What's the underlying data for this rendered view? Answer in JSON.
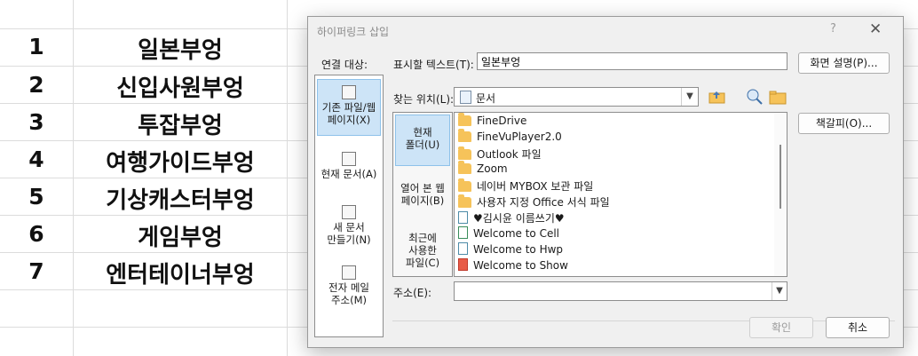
{
  "sheet": {
    "rows": [
      {
        "num": "1",
        "text": "일본부엉"
      },
      {
        "num": "2",
        "text": "신입사원부엉"
      },
      {
        "num": "3",
        "text": "투잡부엉"
      },
      {
        "num": "4",
        "text": "여행가이드부엉"
      },
      {
        "num": "5",
        "text": "기상캐스터부엉"
      },
      {
        "num": "6",
        "text": "게임부엉"
      },
      {
        "num": "7",
        "text": "엔터테이너부엉"
      }
    ]
  },
  "dialog": {
    "title": "하이퍼링크 삽입",
    "help": "?",
    "close": "✕",
    "link_to_label": "연결 대상:",
    "display_text_label": "표시할 텍스트(T):",
    "display_text_value": "일본부엉",
    "screentip_button": "화면 설명(P)...",
    "look_in_label": "찾는 위치(L):",
    "look_in_value": "문서",
    "bookmark_button": "책갈피(O)...",
    "link_types": [
      {
        "label1": "기존 파일/웹",
        "label2": "페이지(X)"
      },
      {
        "label1": "현재 문서(A)",
        "label2": ""
      },
      {
        "label1": "새 문서",
        "label2": "만들기(N)"
      },
      {
        "label1": "전자 메일",
        "label2": "주소(M)"
      }
    ],
    "locations": [
      {
        "label1": "현재",
        "label2": "폴더(U)",
        "label3": ""
      },
      {
        "label1": "열어 본 웹",
        "label2": "페이지(B)",
        "label3": ""
      },
      {
        "label1": "최근에",
        "label2": "사용한",
        "label3": "파일(C)"
      }
    ],
    "files": [
      {
        "name": "FineDrive",
        "type": "folder"
      },
      {
        "name": "FineVuPlayer2.0",
        "type": "folder"
      },
      {
        "name": "Outlook 파일",
        "type": "folder"
      },
      {
        "name": "Zoom",
        "type": "folder"
      },
      {
        "name": "네이버 MYBOX 보관 파일",
        "type": "folder"
      },
      {
        "name": "사용자 지정 Office 서식 파일",
        "type": "folder"
      },
      {
        "name": "♥김시윤 이름쓰기♥",
        "type": "doc"
      },
      {
        "name": "Welcome to Cell",
        "type": "cell"
      },
      {
        "name": "Welcome to Hwp",
        "type": "doc"
      },
      {
        "name": "Welcome to Show",
        "type": "show"
      }
    ],
    "address_label": "주소(E):",
    "address_value": "",
    "ok_button": "확인",
    "cancel_button": "취소"
  }
}
